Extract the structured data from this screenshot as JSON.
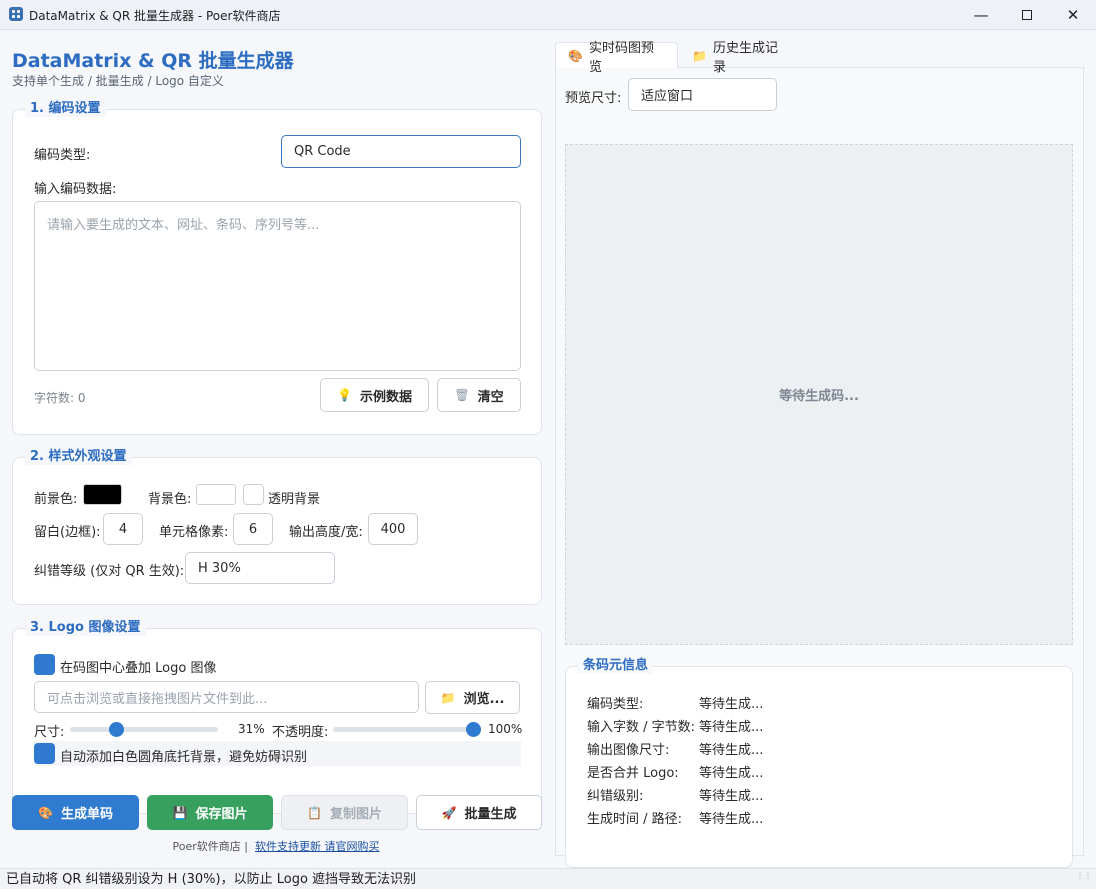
{
  "window": {
    "title": "DataMatrix & QR 批量生成器 - Poer软件商店",
    "controls": [
      "minimize",
      "maximize",
      "close"
    ]
  },
  "header": {
    "title": "DataMatrix & QR 批量生成器",
    "subtitle": "支持单个生成 / 批量生成 / Logo 自定义"
  },
  "encoding": {
    "group_title": "1. 编码设置",
    "type_label": "编码类型:",
    "type_value": "QR Code",
    "data_label": "输入编码数据:",
    "data_placeholder": "请输入要生成的文本、网址、条码、序列号等...",
    "char_count": "字符数: 0",
    "sample_button": "示例数据",
    "clear_button": "清空"
  },
  "style": {
    "group_title": "2. 样式外观设置",
    "fg_label": "前景色:",
    "fg_color": "#000000",
    "bg_label": "背景色:",
    "bg_color": "#ffffff",
    "transparent_label": "透明背景",
    "transparent_checked": false,
    "margin_label": "留白(边框):",
    "margin_value": "4",
    "cell_label": "单元格像素:",
    "cell_value": "6",
    "size_label": "输出高度/宽:",
    "size_value": "400",
    "ecc_label": "纠错等级 (仅对 QR 生效):",
    "ecc_value": "H 30%"
  },
  "logo": {
    "group_title": "3. Logo 图像设置",
    "overlay_label": "在码图中心叠加 Logo 图像",
    "overlay_checked": true,
    "path_placeholder": "可点击浏览或直接拖拽图片文件到此...",
    "browse_button": "浏览...",
    "size_label": "尺寸:",
    "size_percent": 31,
    "size_text": "31%",
    "opacity_label": "不透明度:",
    "opacity_percent": 100,
    "opacity_text": "100%",
    "autobg_label": "自动添加白色圆角底托背景，避免妨碍识别",
    "autobg_checked": true
  },
  "actions": {
    "generate": "生成单码",
    "save": "保存图片",
    "copy": "复制图片",
    "batch": "批量生成"
  },
  "footer": {
    "store": "Poer软件商店 |",
    "link": "软件支持更新 请官网购买"
  },
  "tabs": [
    {
      "label": "实时码图预览",
      "icon": "palette-icon",
      "active": true
    },
    {
      "label": "历史生成记录",
      "icon": "folder-icon",
      "active": false
    }
  ],
  "preview": {
    "size_label": "预览尺寸:",
    "size_value": "适应窗口",
    "waiting": "等待生成码..."
  },
  "meta": {
    "group_title": "条码元信息",
    "rows": [
      {
        "label": "编码类型:",
        "value": "等待生成..."
      },
      {
        "label": "输入字数 / 字节数:",
        "value": "等待生成..."
      },
      {
        "label": "输出图像尺寸:",
        "value": "等待生成..."
      },
      {
        "label": "是否合并 Logo:",
        "value": "等待生成..."
      },
      {
        "label": "纠错级别:",
        "value": "等待生成..."
      },
      {
        "label": "生成时间 / 路径:",
        "value": "等待生成..."
      }
    ]
  },
  "status_bar": "已自动将 QR 纠错级别设为 H (30%)，以防止 Logo 遮挡导致无法识别",
  "colors": {
    "accent": "#2f7bd0",
    "title_blue": "#2d6cc0",
    "save_green": "#38a05e"
  }
}
